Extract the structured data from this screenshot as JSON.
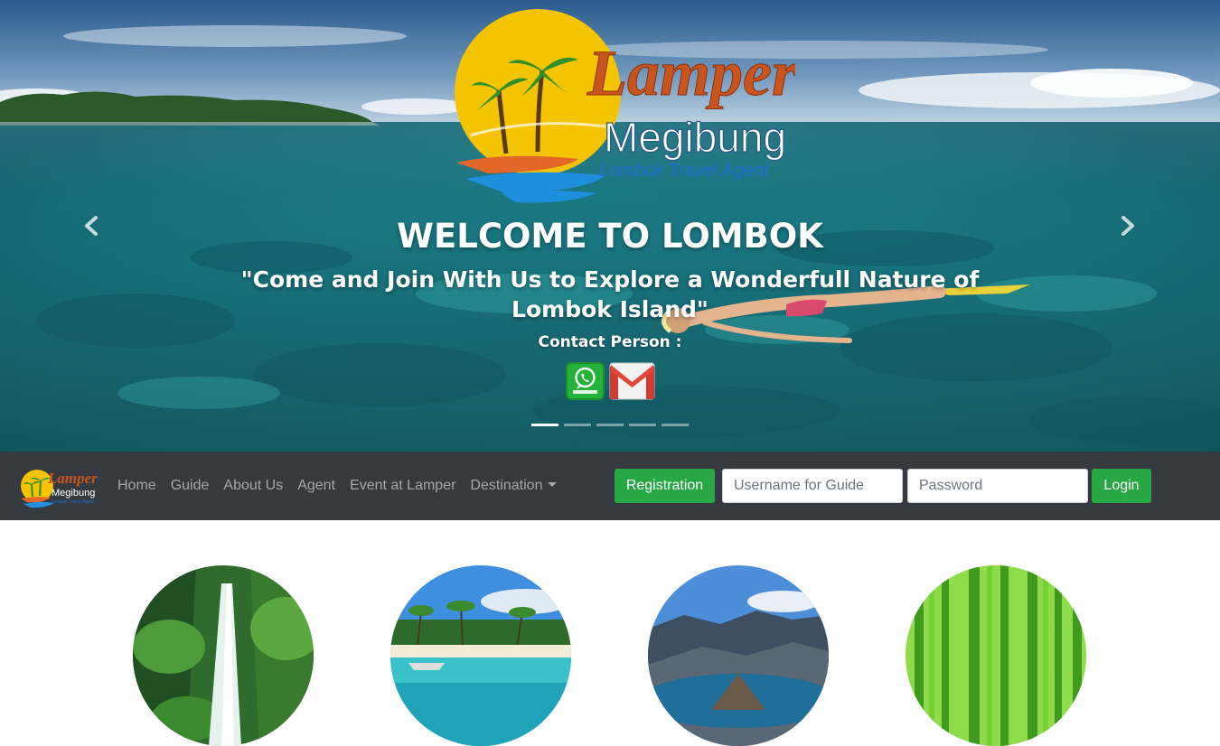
{
  "hero": {
    "title": "WELCOME TO LOMBOK",
    "subtitle": "\"Come and Join With Us to Explore a Wonderfull Nature of Lombok Island\"",
    "contact_label": "Contact Person :",
    "logo": {
      "word1": "Lamper",
      "word2": "Megibung",
      "tagline": "Lombok Travel Agent"
    },
    "slides": 5,
    "active_slide": 1
  },
  "navbar": {
    "links": [
      "Home",
      "Guide",
      "About Us",
      "Agent",
      "Event at Lamper",
      "Destination"
    ],
    "registration_label": "Registration",
    "username_placeholder": "Username for Guide",
    "password_placeholder": "Password",
    "login_label": "Login"
  },
  "destinations": [
    "waterfall",
    "beach",
    "crater-lake",
    "bamboo-forest"
  ],
  "colors": {
    "navbar_bg": "#343a40",
    "button_green": "#28a745",
    "logo_orange": "#c8541e",
    "logo_yellow": "#f5c400"
  }
}
